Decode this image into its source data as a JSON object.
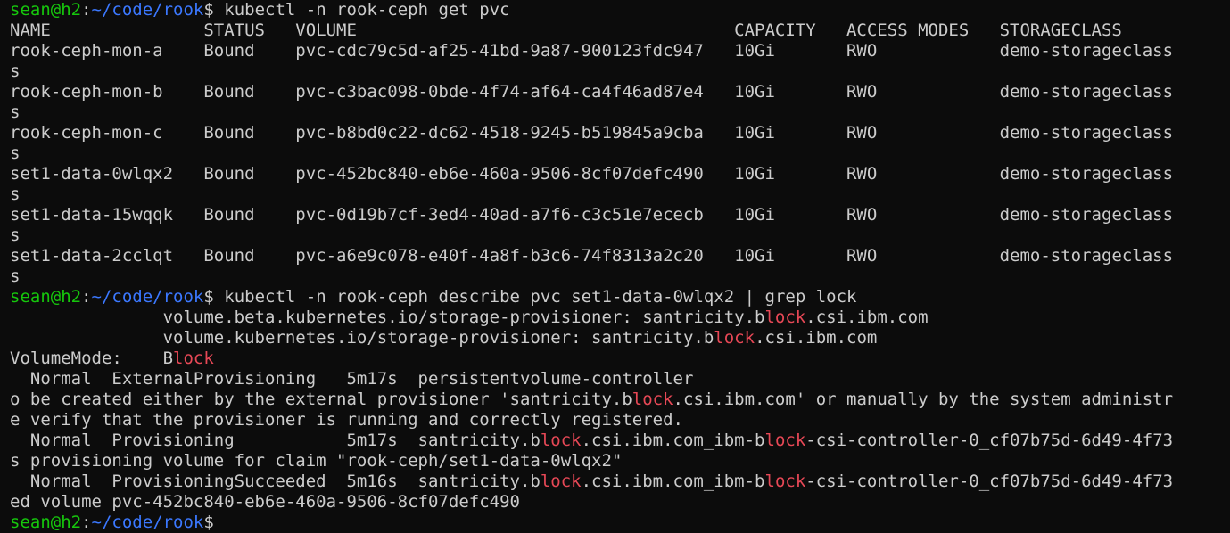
{
  "colors": {
    "background": "#0c0c0c",
    "foreground": "#cccccc",
    "user_host": "#16c60c",
    "path": "#3b78ff",
    "grep_match": "#e74856"
  },
  "prompt": {
    "user_host": "sean@h2",
    "separator": ":",
    "path": "~/code/rook",
    "symbol": "$"
  },
  "lines": [
    {
      "type": "prompt",
      "command": " kubectl -n rook-ceph get pvc"
    },
    {
      "type": "text",
      "segments": [
        {
          "text": "NAME               STATUS   VOLUME                                     CAPACITY   ACCESS MODES   STORAGECLASS"
        }
      ]
    },
    {
      "type": "text",
      "segments": [
        {
          "text": "rook-ceph-mon-a    Bound    pvc-cdc79c5d-af25-41bd-9a87-900123fdc947   10Gi       RWO            demo-storageclass"
        }
      ]
    },
    {
      "type": "text",
      "segments": [
        {
          "text": "s"
        }
      ]
    },
    {
      "type": "text",
      "segments": [
        {
          "text": "rook-ceph-mon-b    Bound    pvc-c3bac098-0bde-4f74-af64-ca4f46ad87e4   10Gi       RWO            demo-storageclass"
        }
      ]
    },
    {
      "type": "text",
      "segments": [
        {
          "text": "s"
        }
      ]
    },
    {
      "type": "text",
      "segments": [
        {
          "text": "rook-ceph-mon-c    Bound    pvc-b8bd0c22-dc62-4518-9245-b519845a9cba   10Gi       RWO            demo-storageclass"
        }
      ]
    },
    {
      "type": "text",
      "segments": [
        {
          "text": "s"
        }
      ]
    },
    {
      "type": "text",
      "segments": [
        {
          "text": "set1-data-0wlqx2   Bound    pvc-452bc840-eb6e-460a-9506-8cf07defc490   10Gi       RWO            demo-storageclass"
        }
      ]
    },
    {
      "type": "text",
      "segments": [
        {
          "text": "s"
        }
      ]
    },
    {
      "type": "text",
      "segments": [
        {
          "text": "set1-data-15wqqk   Bound    pvc-0d19b7cf-3ed4-40ad-a7f6-c3c51e7ececb   10Gi       RWO            demo-storageclass"
        }
      ]
    },
    {
      "type": "text",
      "segments": [
        {
          "text": "s"
        }
      ]
    },
    {
      "type": "text",
      "segments": [
        {
          "text": "set1-data-2cclqt   Bound    pvc-a6e9c078-e40f-4a8f-b3c6-74f8313a2c20   10Gi       RWO            demo-storageclass"
        }
      ]
    },
    {
      "type": "text",
      "segments": [
        {
          "text": "s"
        }
      ]
    },
    {
      "type": "prompt",
      "command": " kubectl -n rook-ceph describe pvc set1-data-0wlqx2 | grep lock"
    },
    {
      "type": "text",
      "segments": [
        {
          "text": "               volume.beta.kubernetes.io/storage-provisioner: santricity.b"
        },
        {
          "text": "lock",
          "match": true
        },
        {
          "text": ".csi.ibm.com"
        }
      ]
    },
    {
      "type": "text",
      "segments": [
        {
          "text": "               volume.kubernetes.io/storage-provisioner: santricity.b"
        },
        {
          "text": "lock",
          "match": true
        },
        {
          "text": ".csi.ibm.com"
        }
      ]
    },
    {
      "type": "text",
      "segments": [
        {
          "text": "VolumeMode:    B"
        },
        {
          "text": "lock",
          "match": true
        }
      ]
    },
    {
      "type": "text",
      "segments": [
        {
          "text": "  Normal  ExternalProvisioning   5m17s  persistentvolume-controller"
        }
      ]
    },
    {
      "type": "text",
      "segments": [
        {
          "text": "o be created either by the external provisioner 'santricity.b"
        },
        {
          "text": "lock",
          "match": true
        },
        {
          "text": ".csi.ibm.com' or manually by the system administr"
        }
      ]
    },
    {
      "type": "text",
      "segments": [
        {
          "text": "e verify that the provisioner is running and correctly registered."
        }
      ]
    },
    {
      "type": "text",
      "segments": [
        {
          "text": "  Normal  Provisioning           5m17s  santricity.b"
        },
        {
          "text": "lock",
          "match": true
        },
        {
          "text": ".csi.ibm.com_ibm-b"
        },
        {
          "text": "lock",
          "match": true
        },
        {
          "text": "-csi-controller-0_cf07b75d-6d49-4f73"
        }
      ]
    },
    {
      "type": "text",
      "segments": [
        {
          "text": "s provisioning volume for claim \"rook-ceph/set1-data-0wlqx2\""
        }
      ]
    },
    {
      "type": "text",
      "segments": [
        {
          "text": "  Normal  ProvisioningSucceeded  5m16s  santricity.b"
        },
        {
          "text": "lock",
          "match": true
        },
        {
          "text": ".csi.ibm.com_ibm-b"
        },
        {
          "text": "lock",
          "match": true
        },
        {
          "text": "-csi-controller-0_cf07b75d-6d49-4f73"
        }
      ]
    },
    {
      "type": "text",
      "segments": [
        {
          "text": "ed volume pvc-452bc840-eb6e-460a-9506-8cf07defc490"
        }
      ]
    },
    {
      "type": "prompt",
      "command": ""
    }
  ]
}
